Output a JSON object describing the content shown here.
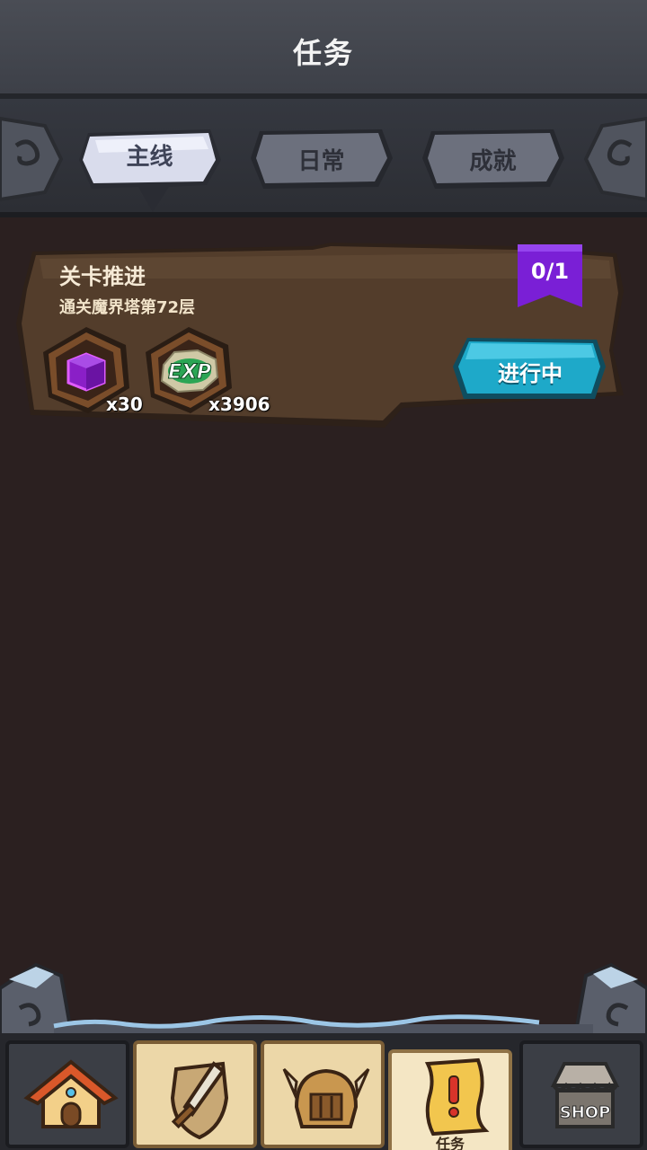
{
  "header": {
    "title": "任务"
  },
  "tabs": [
    {
      "label": "主线",
      "active": true
    },
    {
      "label": "日常",
      "active": false
    },
    {
      "label": "成就",
      "active": false
    }
  ],
  "quest": {
    "title": "关卡推进",
    "description": "通关魔界塔第72层",
    "progress": "0/1",
    "status_button": "进行中",
    "rewards": [
      {
        "icon": "purple-cube-icon",
        "count": "x30"
      },
      {
        "icon": "exp-icon",
        "count": "x3906",
        "icon_text": "EXP"
      }
    ]
  },
  "bottom_nav": [
    {
      "icon": "home-icon",
      "label": ""
    },
    {
      "icon": "sword-shield-icon",
      "label": ""
    },
    {
      "icon": "helmet-icon",
      "label": ""
    },
    {
      "icon": "quest-scroll-icon",
      "label": "任务",
      "active": true
    },
    {
      "icon": "shop-icon",
      "label": "",
      "icon_text": "SHOP"
    }
  ],
  "colors": {
    "background": "#2b2020",
    "card": "#4e3a2a",
    "progress_flag": "#7a1fd6",
    "status_button": "#1ea9c9"
  }
}
